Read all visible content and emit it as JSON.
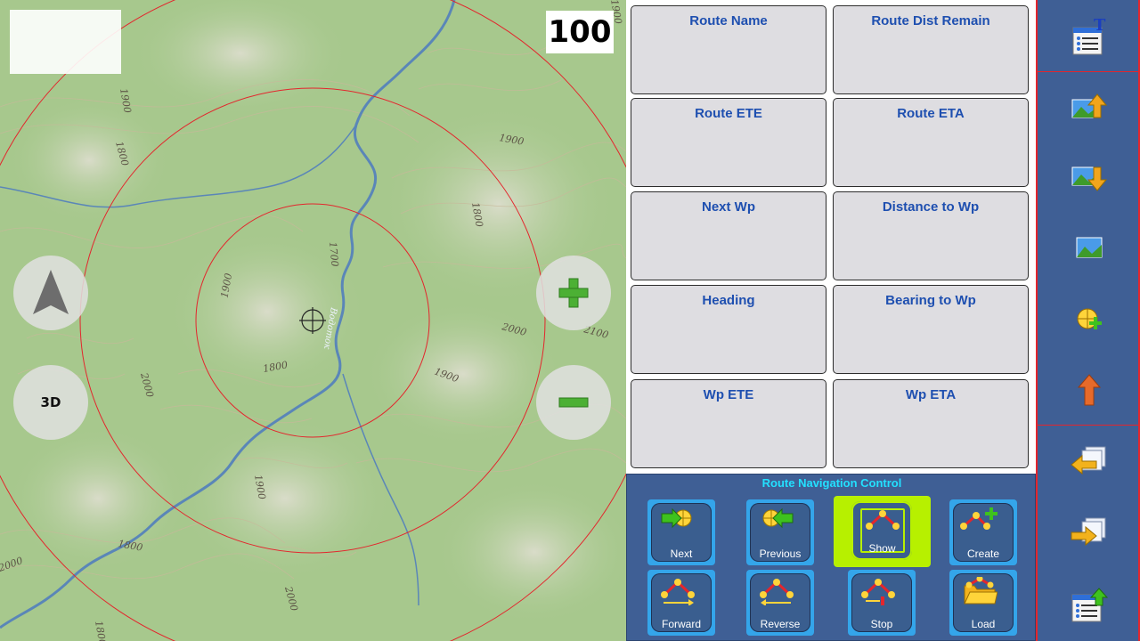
{
  "map": {
    "zoom_level": "100",
    "three_d_label": "3D",
    "contour_labels": [
      "1900",
      "1800",
      "1900",
      "1800",
      "1700",
      "1900",
      "1800",
      "2000",
      "2100",
      "2000",
      "1900",
      "1900",
      "2000",
      "1800",
      "2000",
      "1900",
      "1800"
    ],
    "river_label": "Водоток"
  },
  "data_fields": [
    {
      "title": "Route Name"
    },
    {
      "title": "Route Dist Remain"
    },
    {
      "title": "Route ETE"
    },
    {
      "title": "Route ETA"
    },
    {
      "title": "Next Wp"
    },
    {
      "title": "Distance to Wp"
    },
    {
      "title": "Heading"
    },
    {
      "title": "Bearing to Wp"
    },
    {
      "title": "Wp ETE"
    },
    {
      "title": "Wp ETA"
    }
  ],
  "nav_control": {
    "title": "Route Navigation Control",
    "buttons": [
      {
        "label": "Next",
        "icon": "next-waypoint-icon"
      },
      {
        "label": "Previous",
        "icon": "previous-waypoint-icon"
      },
      {
        "label": "Show",
        "icon": "show-route-icon",
        "active": true
      },
      {
        "label": "Create",
        "icon": "create-route-icon"
      },
      {
        "label": "Forward",
        "icon": "forward-route-icon"
      },
      {
        "label": "Reverse",
        "icon": "reverse-route-icon"
      },
      {
        "label": "Stop",
        "icon": "stop-route-icon"
      },
      {
        "label": "Load",
        "icon": "load-route-icon"
      }
    ]
  },
  "sidebar": {
    "buttons": [
      {
        "icon": "data-fields-config-icon"
      },
      {
        "icon": "map-up-icon"
      },
      {
        "icon": "map-down-icon"
      },
      {
        "icon": "map-layer-icon"
      },
      {
        "icon": "add-waypoint-icon"
      },
      {
        "icon": "arrow-up-icon"
      },
      {
        "icon": "switch-back-icon"
      },
      {
        "icon": "switch-forward-icon"
      },
      {
        "icon": "export-list-icon"
      }
    ]
  },
  "colors": {
    "panel_blue": "#3f5f95",
    "field_title": "#1e4fb0",
    "nav_title": "#23e0ff",
    "active_highlight": "#b7f000",
    "range_ring": "#e3262d"
  }
}
